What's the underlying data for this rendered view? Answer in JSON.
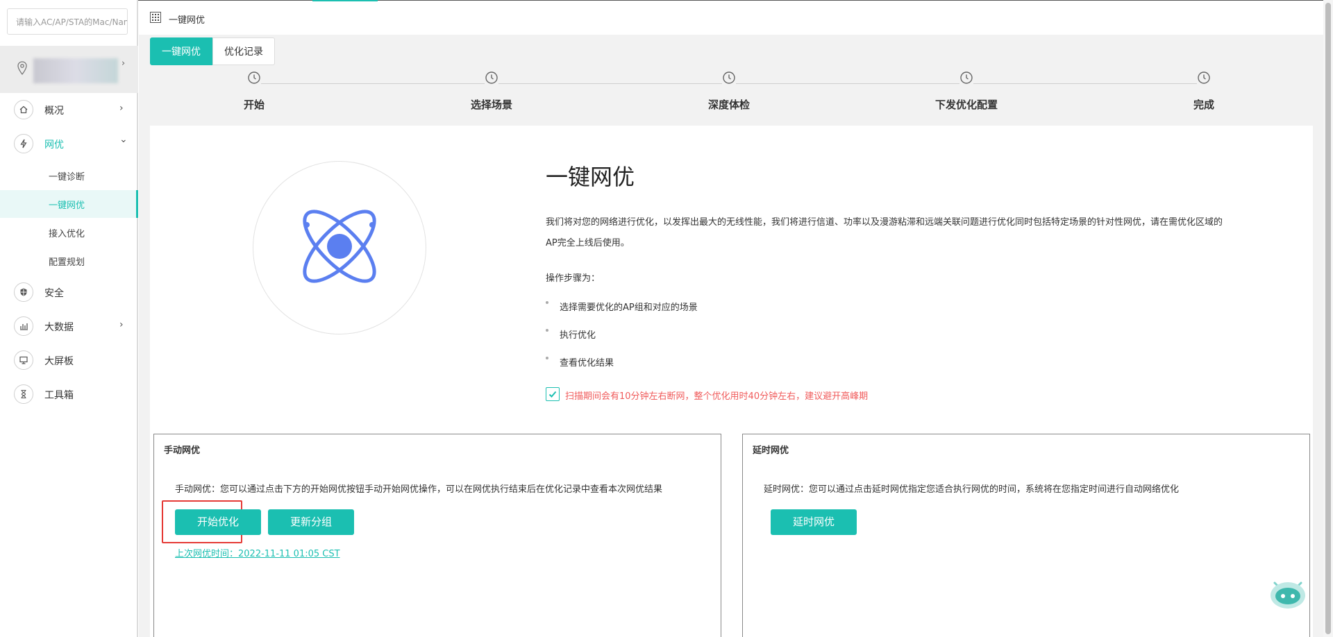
{
  "sidebar": {
    "search_placeholder": "请输入AC/AP/STA的Mac/Name",
    "items": [
      {
        "label": "概况",
        "icon": "home-icon"
      },
      {
        "label": "网优",
        "icon": "lightning-icon"
      },
      {
        "label": "安全",
        "icon": "shield-icon"
      },
      {
        "label": "大数据",
        "icon": "bar-chart-icon"
      },
      {
        "label": "大屏板",
        "icon": "monitor-icon"
      },
      {
        "label": "工具箱",
        "icon": "hourglass-icon"
      }
    ],
    "subitems": [
      "一键诊断",
      "一键网优",
      "接入优化",
      "配置规划"
    ],
    "chevron_right": "›",
    "chevron_down": "⌄"
  },
  "header": {
    "title": "一键网优"
  },
  "tabs": [
    "一键网优",
    "优化记录"
  ],
  "steps": [
    "开始",
    "选择场景",
    "深度体检",
    "下发优化配置",
    "完成"
  ],
  "main": {
    "title": "一键网优",
    "description": "我们将对您的网络进行优化，以发挥出最大的无线性能，我们将进行信道、功率以及漫游粘滞和远端关联问题进行优化同时包括特定场景的针对性网优，请在需优化区域的AP完全上线后使用。",
    "steps_title": "操作步骤为：",
    "bullets": [
      "选择需要优化的AP组和对应的场景",
      "执行优化",
      "查看优化结果"
    ],
    "warning": "扫描期间会有10分钟左右断网，整个优化用时40分钟左右，建议避开高峰期"
  },
  "manual": {
    "title": "手动网优",
    "description": "手动网优：您可以通过点击下方的开始网优按钮手动开始网优操作，可以在网优执行结束后在优化记录中查看本次网优结果",
    "start_button": "开始优化",
    "update_button": "更新分组",
    "last_time": "上次网优时间：2022-11-11 01:05 CST"
  },
  "delayed": {
    "title": "延时网优",
    "description": "延时网优：您可以通过点击延时网优指定您适合执行网优的时间，系统将在您指定时间进行自动网络优化",
    "button": "延时网优"
  },
  "colors": {
    "accent": "#1bbfb1",
    "warning": "#f05a5a",
    "atom": "#5b7ff0",
    "highlight": "#e53935"
  }
}
